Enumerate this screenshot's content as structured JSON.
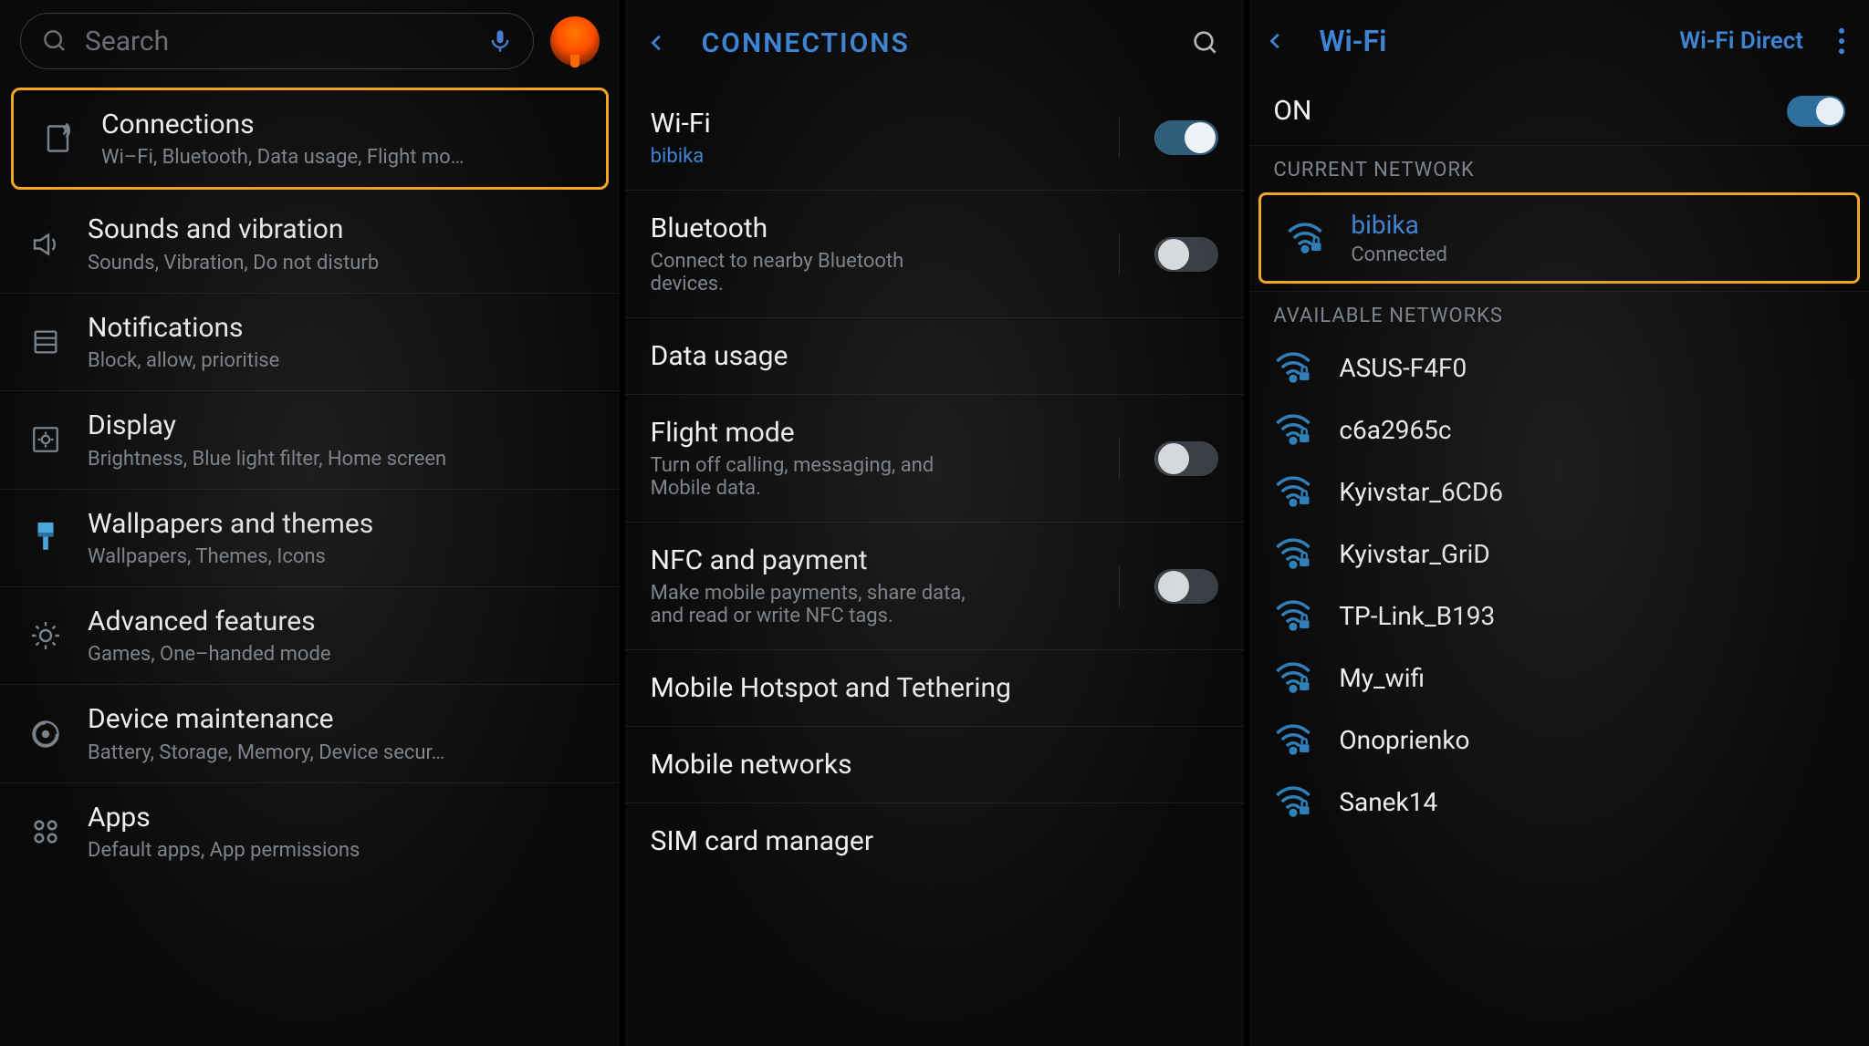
{
  "panel1": {
    "search_placeholder": "Search",
    "items": [
      {
        "title": "Connections",
        "sub": "Wi–Fi, Bluetooth, Data usage, Flight mo…"
      },
      {
        "title": "Sounds and vibration",
        "sub": "Sounds, Vibration, Do not disturb"
      },
      {
        "title": "Notifications",
        "sub": "Block, allow, prioritise"
      },
      {
        "title": "Display",
        "sub": "Brightness, Blue light filter, Home screen"
      },
      {
        "title": "Wallpapers and themes",
        "sub": "Wallpapers, Themes, Icons"
      },
      {
        "title": "Advanced features",
        "sub": "Games, One–handed mode"
      },
      {
        "title": "Device maintenance",
        "sub": "Battery, Storage, Memory, Device secur…"
      },
      {
        "title": "Apps",
        "sub": "Default apps, App permissions"
      }
    ]
  },
  "panel2": {
    "header": "CONNECTIONS",
    "items": [
      {
        "title": "Wi-Fi",
        "sub": "bibika",
        "sublink": true,
        "toggle": "on"
      },
      {
        "title": "Bluetooth",
        "sub": "Connect to nearby Bluetooth devices.",
        "toggle": "off"
      },
      {
        "title": "Data usage"
      },
      {
        "title": "Flight mode",
        "sub": "Turn off calling, messaging, and Mobile data.",
        "toggle": "off"
      },
      {
        "title": "NFC and payment",
        "sub": "Make mobile payments, share data, and read or write NFC tags.",
        "toggle": "off"
      },
      {
        "title": "Mobile Hotspot and Tethering"
      },
      {
        "title": "Mobile networks"
      },
      {
        "title": "SIM card manager"
      }
    ]
  },
  "panel3": {
    "header": "Wi-Fi",
    "direct": "Wi-Fi Direct",
    "on_label": "ON",
    "section_current": "CURRENT NETWORK",
    "current": {
      "ssid": "bibika",
      "status": "Connected"
    },
    "section_avail": "AVAILABLE NETWORKS",
    "networks": [
      "ASUS-F4F0",
      "c6a2965c",
      "Kyivstar_6CD6",
      "Kyivstar_GriD",
      "TP-Link_B193",
      "My_wifi",
      "Onoprienko",
      "Sanek14"
    ]
  }
}
